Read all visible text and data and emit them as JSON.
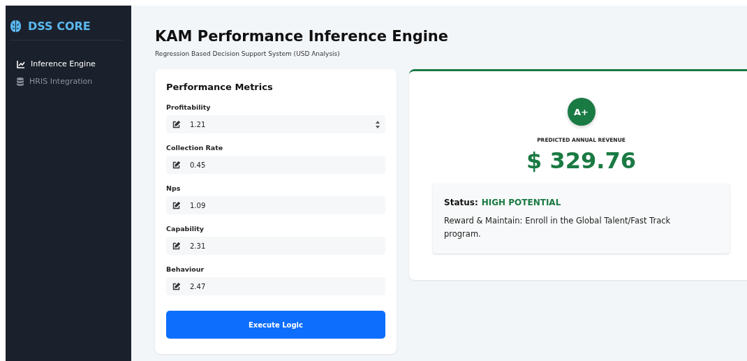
{
  "sidebar": {
    "brand": "DSS CORE",
    "items": [
      {
        "label": "Inference Engine",
        "selected": true
      },
      {
        "label": "HRIS Integration",
        "selected": false
      }
    ]
  },
  "header": {
    "title": "KAM Performance Inference Engine",
    "subtitle": "Regression Based Decision Support System (USD Analysis)"
  },
  "metrics": {
    "title": "Performance Metrics",
    "fields": [
      {
        "label": "Profitability",
        "value": "1.21",
        "spinner": true
      },
      {
        "label": "Collection Rate",
        "value": "0.45",
        "spinner": false
      },
      {
        "label": "Nps",
        "value": "1.09",
        "spinner": false
      },
      {
        "label": "Capability",
        "value": "2.31",
        "spinner": false
      },
      {
        "label": "Behaviour",
        "value": "2.47",
        "spinner": false
      }
    ],
    "button": "Execute Logic"
  },
  "result": {
    "grade": "A+",
    "caption": "PREDICTED ANNUAL REVENUE",
    "revenue": "$ 329.76",
    "status_label": "Status:",
    "status_value": "HIGH POTENTIAL",
    "recommendation": "Reward & Maintain: Enroll in the Global Talent/Fast Track program."
  }
}
